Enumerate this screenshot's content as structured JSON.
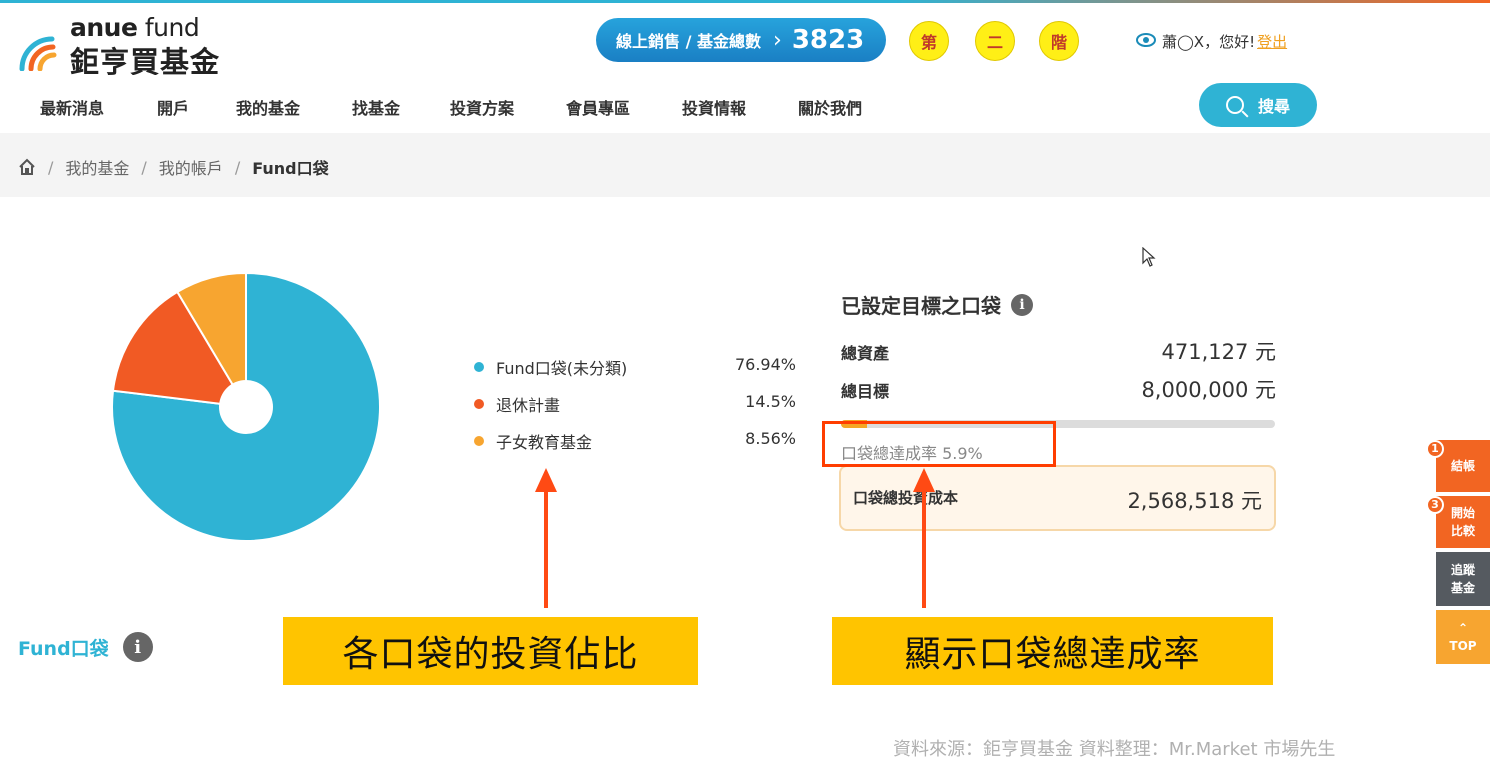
{
  "header": {
    "logo_en_bold": "anue",
    "logo_en_thin": " fund",
    "logo_zh": "鉅亨買基金",
    "sales_label": "線上銷售 / 基金總數",
    "sales_arrow": "›",
    "fund_count": "3823",
    "steps": [
      "第",
      "二",
      "階"
    ],
    "greeting_name": "蕭◯X，您好!",
    "logout": "登出",
    "colors": {
      "brand": "#2fb3d4",
      "accent": "#f26522"
    }
  },
  "nav": {
    "items": [
      "最新消息",
      "開戶",
      "我的基金",
      "找基金",
      "投資方案",
      "會員專區",
      "投資情報",
      "關於我們"
    ],
    "search_label": "搜尋"
  },
  "breadcrumb": {
    "items": [
      "我的基金",
      "我的帳戶"
    ],
    "current": "Fund口袋",
    "separator": "/"
  },
  "allocation": {
    "legend": [
      {
        "name": "Fund口袋(未分類)",
        "pct": "76.94%",
        "value": 76.94,
        "color": "#2fb3d4"
      },
      {
        "name": "退休計畫",
        "pct": "14.5%",
        "value": 14.5,
        "color": "#f15a24"
      },
      {
        "name": "子女教育基金",
        "pct": "8.56%",
        "value": 8.56,
        "color": "#f7a530"
      }
    ]
  },
  "goal": {
    "title": "已設定目標之口袋",
    "info": "i",
    "total_assets_label": "總資產",
    "total_assets_value": "471,127 元",
    "total_goal_label": "總目標",
    "total_goal_value": "8,000,000 元",
    "rate_text": "口袋總達成率 5.9%",
    "rate_value": 5.9,
    "cost_label": "口袋總投資成本",
    "cost_value": "2,568,518 元"
  },
  "annotations": {
    "left_callout": "各口袋的投資佔比",
    "right_callout": "顯示口袋總達成率"
  },
  "bottom": {
    "section_title": "Fund口袋",
    "info": "i",
    "source": "資料來源：鉅亨買基金  資料整理：Mr.Market 市場先生"
  },
  "side_widget": [
    {
      "badge": "1",
      "label_1": "結帳",
      "label_2": "",
      "color": "#f26522"
    },
    {
      "badge": "3",
      "label_1": "開始",
      "label_2": "比較",
      "color": "#f26522"
    },
    {
      "badge": "",
      "label_1": "追蹤",
      "label_2": "基金",
      "color": "#555a60"
    },
    {
      "badge": "",
      "label_1": "⌃",
      "label_2": "TOP",
      "color": "#f7a530"
    }
  ]
}
